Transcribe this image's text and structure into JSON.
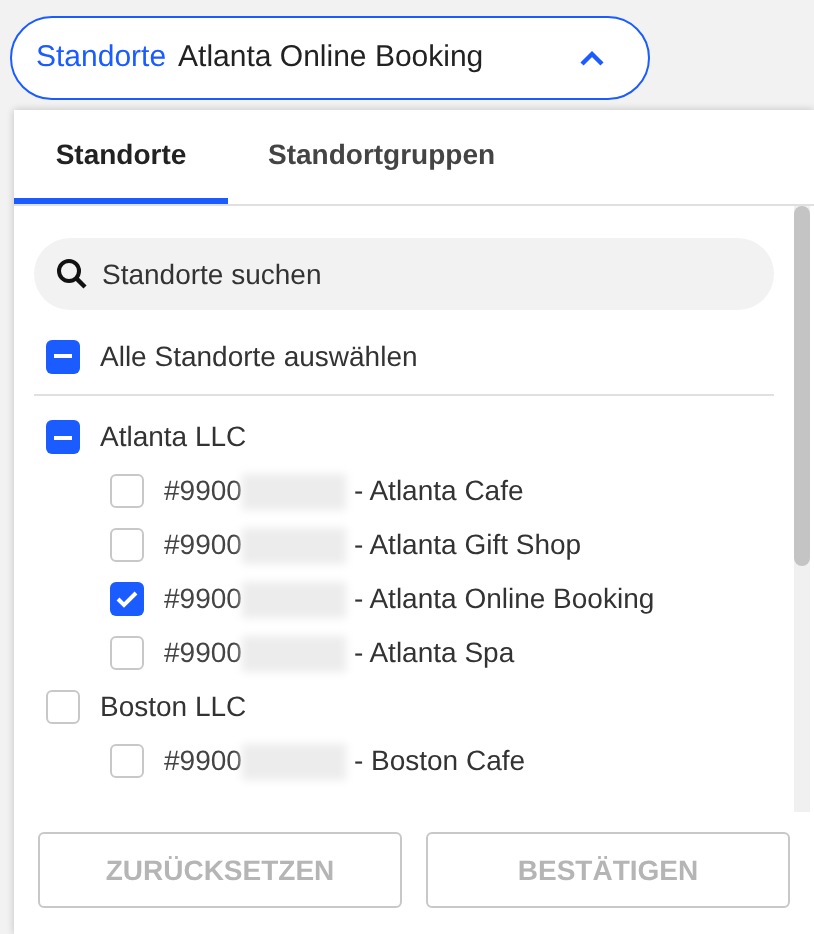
{
  "selector": {
    "label": "Standorte",
    "value": "Atlanta Online Booking",
    "expanded": true
  },
  "tabs": [
    {
      "label": "Standorte",
      "selected": true
    },
    {
      "label": "Standortgruppen",
      "selected": false
    }
  ],
  "search": {
    "placeholder": "Standorte suchen"
  },
  "select_all": {
    "label": "Alle Standorte auswählen",
    "checked": false,
    "partial": true
  },
  "groups": [
    {
      "label": "Atlanta LLC",
      "checked": false,
      "partial": true,
      "children": [
        {
          "code": "#9900",
          "label": "- Atlanta Cafe",
          "checked": false
        },
        {
          "code": "#9900",
          "label": "- Atlanta Gift Shop",
          "checked": false
        },
        {
          "code": "#9900",
          "label": "- Atlanta Online Booking",
          "checked": true
        },
        {
          "code": "#9900",
          "label": "- Atlanta Spa",
          "checked": false
        }
      ]
    },
    {
      "label": "Boston LLC",
      "checked": false,
      "partial": false,
      "children": [
        {
          "code": "#9900",
          "label": "- Boston Cafe",
          "checked": false
        }
      ]
    }
  ],
  "buttons": [
    {
      "label": "ZURÜCKSETZEN",
      "disabled": true
    },
    {
      "label": "BESTÄTIGEN",
      "disabled": true
    }
  ]
}
